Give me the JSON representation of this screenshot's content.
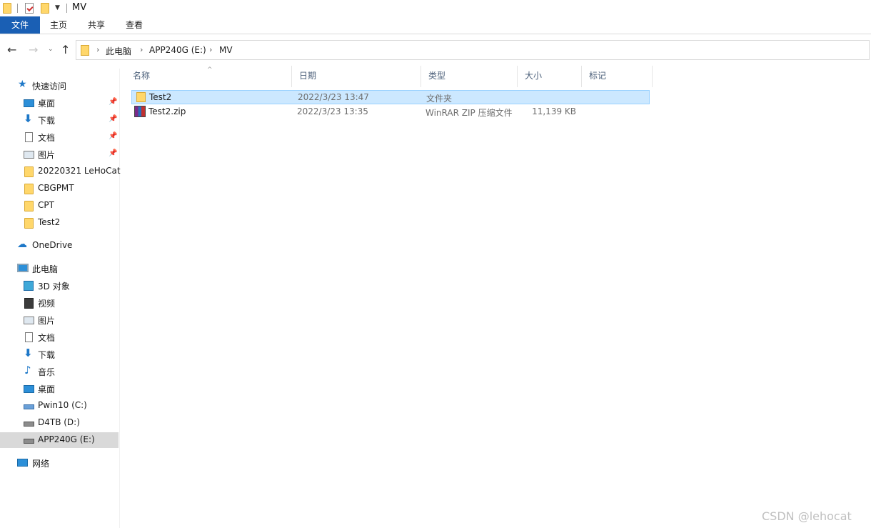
{
  "window": {
    "title": "MV"
  },
  "ribbon": {
    "tabs": [
      "文件",
      "主页",
      "共享",
      "查看"
    ]
  },
  "address": {
    "crumbs": [
      "此电脑",
      "APP240G (E:)",
      "MV"
    ]
  },
  "sidebar": {
    "quick_access": "快速访问",
    "pinned": [
      {
        "label": "桌面",
        "icon": "desktop-icon"
      },
      {
        "label": "下载",
        "icon": "download-icon"
      },
      {
        "label": "文档",
        "icon": "document-icon"
      },
      {
        "label": "图片",
        "icon": "picture-icon"
      }
    ],
    "recent": [
      "20220321 LeHoCat",
      "CBGPMT",
      "CPT",
      "Test2"
    ],
    "onedrive": "OneDrive",
    "this_pc": "此电脑",
    "pc_items": [
      {
        "label": "3D 对象",
        "icon": "3d-objects-icon"
      },
      {
        "label": "视频",
        "icon": "video-icon"
      },
      {
        "label": "图片",
        "icon": "picture-icon"
      },
      {
        "label": "文档",
        "icon": "document-icon"
      },
      {
        "label": "下载",
        "icon": "download-icon"
      },
      {
        "label": "音乐",
        "icon": "music-icon"
      },
      {
        "label": "桌面",
        "icon": "desktop-icon"
      },
      {
        "label": "Pwin10 (C:)",
        "icon": "windows-drive-icon"
      },
      {
        "label": "D4TB (D:)",
        "icon": "drive-icon"
      },
      {
        "label": "APP240G (E:)",
        "icon": "drive-icon",
        "selected": true
      }
    ],
    "network": "网络"
  },
  "columns": [
    "名称",
    "日期",
    "类型",
    "大小",
    "标记"
  ],
  "files": [
    {
      "name": "Test2",
      "date": "2022/3/23 13:47",
      "type": "文件夹",
      "size": "",
      "icon": "folder-icon",
      "selected": true
    },
    {
      "name": "Test2.zip",
      "date": "2022/3/23 13:35",
      "type": "WinRAR ZIP 压缩文件",
      "size": "11,139 KB",
      "icon": "winrar-zip-icon",
      "selected": false
    }
  ],
  "watermark": "CSDN @lehocat"
}
